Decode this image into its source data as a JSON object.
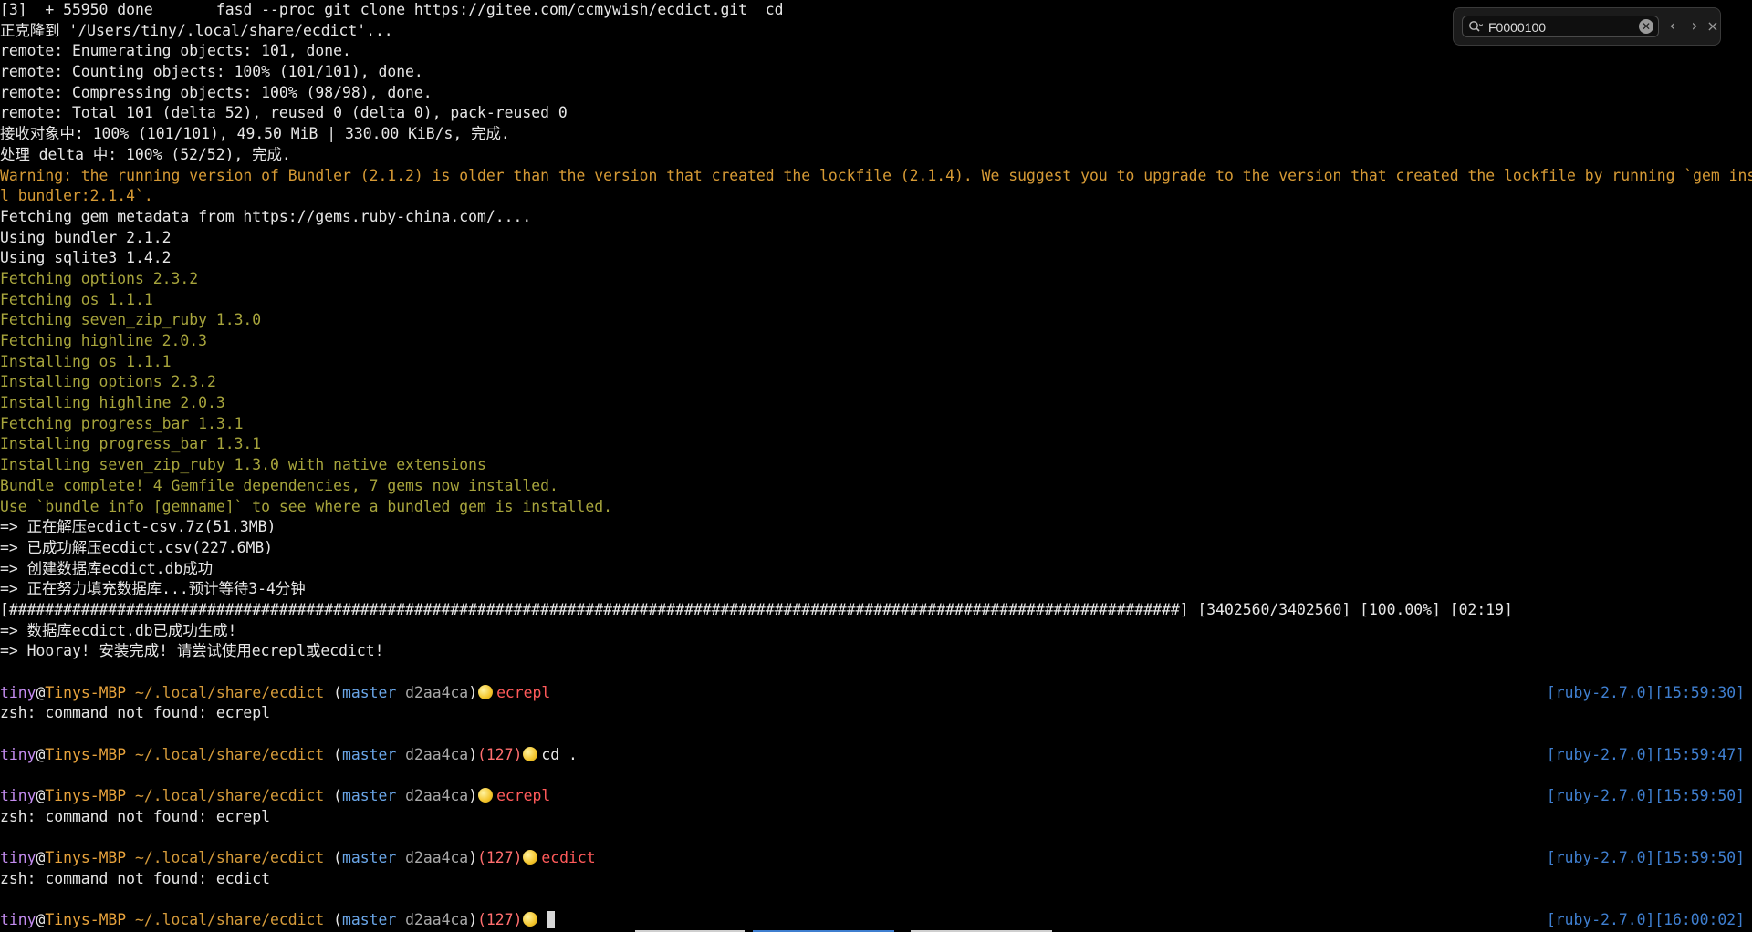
{
  "search": {
    "value": "F0000100",
    "placeholder": "",
    "clear_glyph": "✕",
    "prev_glyph": "‹",
    "next_glyph": "›",
    "close_glyph": "×",
    "icon": "search-icon"
  },
  "colors": {
    "background": "#000000",
    "text": "#e6e6e6",
    "warning": "#d69a35",
    "olive": "#a7a43c",
    "user": "#c48cf0",
    "host": "#e8a33c",
    "branch": "#6aa6e8",
    "error": "#e24a4a",
    "right_prompt": "#3f7fd0"
  },
  "output": [
    {
      "text": "[3]  + 55950 done       fasd --proc git clone https://gitee.com/ccmywish/ecdict.git  cd",
      "color": "white"
    },
    {
      "text": "正克隆到 '/Users/tiny/.local/share/ecdict'...",
      "color": "white"
    },
    {
      "text": "remote: Enumerating objects: 101, done.",
      "color": "white"
    },
    {
      "text": "remote: Counting objects: 100% (101/101), done.",
      "color": "white"
    },
    {
      "text": "remote: Compressing objects: 100% (98/98), done.",
      "color": "white"
    },
    {
      "text": "remote: Total 101 (delta 52), reused 0 (delta 0), pack-reused 0",
      "color": "white"
    },
    {
      "text": "接收对象中: 100% (101/101), 49.50 MiB | 330.00 KiB/s, 完成.",
      "color": "white"
    },
    {
      "text": "处理 delta 中: 100% (52/52), 完成.",
      "color": "white"
    },
    {
      "text": "Warning: the running version of Bundler (2.1.2) is older than the version that created the lockfile (2.1.4). We suggest you to upgrade to the version that created the lockfile by running `gem instal",
      "color": "warn"
    },
    {
      "text": "l bundler:2.1.4`.",
      "color": "warn"
    },
    {
      "text": "Fetching gem metadata from https://gems.ruby-china.com/....",
      "color": "white"
    },
    {
      "text": "Using bundler 2.1.2",
      "color": "white"
    },
    {
      "text": "Using sqlite3 1.4.2",
      "color": "white"
    },
    {
      "text": "Fetching options 2.3.2",
      "color": "olive"
    },
    {
      "text": "Fetching os 1.1.1",
      "color": "olive"
    },
    {
      "text": "Fetching seven_zip_ruby 1.3.0",
      "color": "olive"
    },
    {
      "text": "Fetching highline 2.0.3",
      "color": "olive"
    },
    {
      "text": "Installing os 1.1.1",
      "color": "olive"
    },
    {
      "text": "Installing options 2.3.2",
      "color": "olive"
    },
    {
      "text": "Installing highline 2.0.3",
      "color": "olive"
    },
    {
      "text": "Fetching progress_bar 1.3.1",
      "color": "olive"
    },
    {
      "text": "Installing progress_bar 1.3.1",
      "color": "olive"
    },
    {
      "text": "Installing seven_zip_ruby 1.3.0 with native extensions",
      "color": "olive"
    },
    {
      "text": "Bundle complete! 4 Gemfile dependencies, 7 gems now installed.",
      "color": "olive"
    },
    {
      "text": "Use `bundle info [gemname]` to see where a bundled gem is installed.",
      "color": "olive"
    },
    {
      "text": "=> 正在解压ecdict-csv.7z(51.3MB)",
      "color": "white"
    },
    {
      "text": "=> 已成功解压ecdict.csv(227.6MB)",
      "color": "white"
    },
    {
      "text": "=> 创建数据库ecdict.db成功",
      "color": "white"
    },
    {
      "text": "=> 正在努力填充数据库...预计等待3-4分钟",
      "color": "white"
    },
    {
      "text": "[##################################################################################################################################] [3402560/3402560] [100.00%] [02:19]",
      "color": "white"
    },
    {
      "text": "=> 数据库ecdict.db已成功生成!",
      "color": "white"
    },
    {
      "text": "=> Hooray! 安装完成! 请尝试使用ecrepl或ecdict!",
      "color": "white"
    }
  ],
  "prompt_parts": {
    "user": "tiny",
    "at": "@",
    "host": "Tinys-MBP",
    "path": " ~/.local/share/ecdict ",
    "open_paren": "(",
    "branch": "master",
    "hash": " d2aa4ca",
    "close_paren": ")",
    "ret_127": "(127)"
  },
  "sessions": [
    {
      "ret": false,
      "cmd": "ecrepl",
      "cmd_style": "cmd",
      "right": "[ruby-2.7.0][15:59:30]",
      "output": "zsh: command not found: ecrepl"
    },
    {
      "ret": true,
      "cmd": "cd .",
      "cmd_style": "cmd2",
      "right": "[ruby-2.7.0][15:59:47]",
      "output": ""
    },
    {
      "ret": false,
      "cmd": "ecrepl",
      "cmd_style": "cmd",
      "right": "[ruby-2.7.0][15:59:50]",
      "output": "zsh: command not found: ecrepl"
    },
    {
      "ret": true,
      "cmd": "ecdict",
      "cmd_style": "cmd",
      "right": "[ruby-2.7.0][15:59:50]",
      "output": "zsh: command not found: ecdict"
    },
    {
      "ret": true,
      "cmd": "",
      "cmd_style": "cursor",
      "right": "[ruby-2.7.0][16:00:02]",
      "output": null
    }
  ]
}
